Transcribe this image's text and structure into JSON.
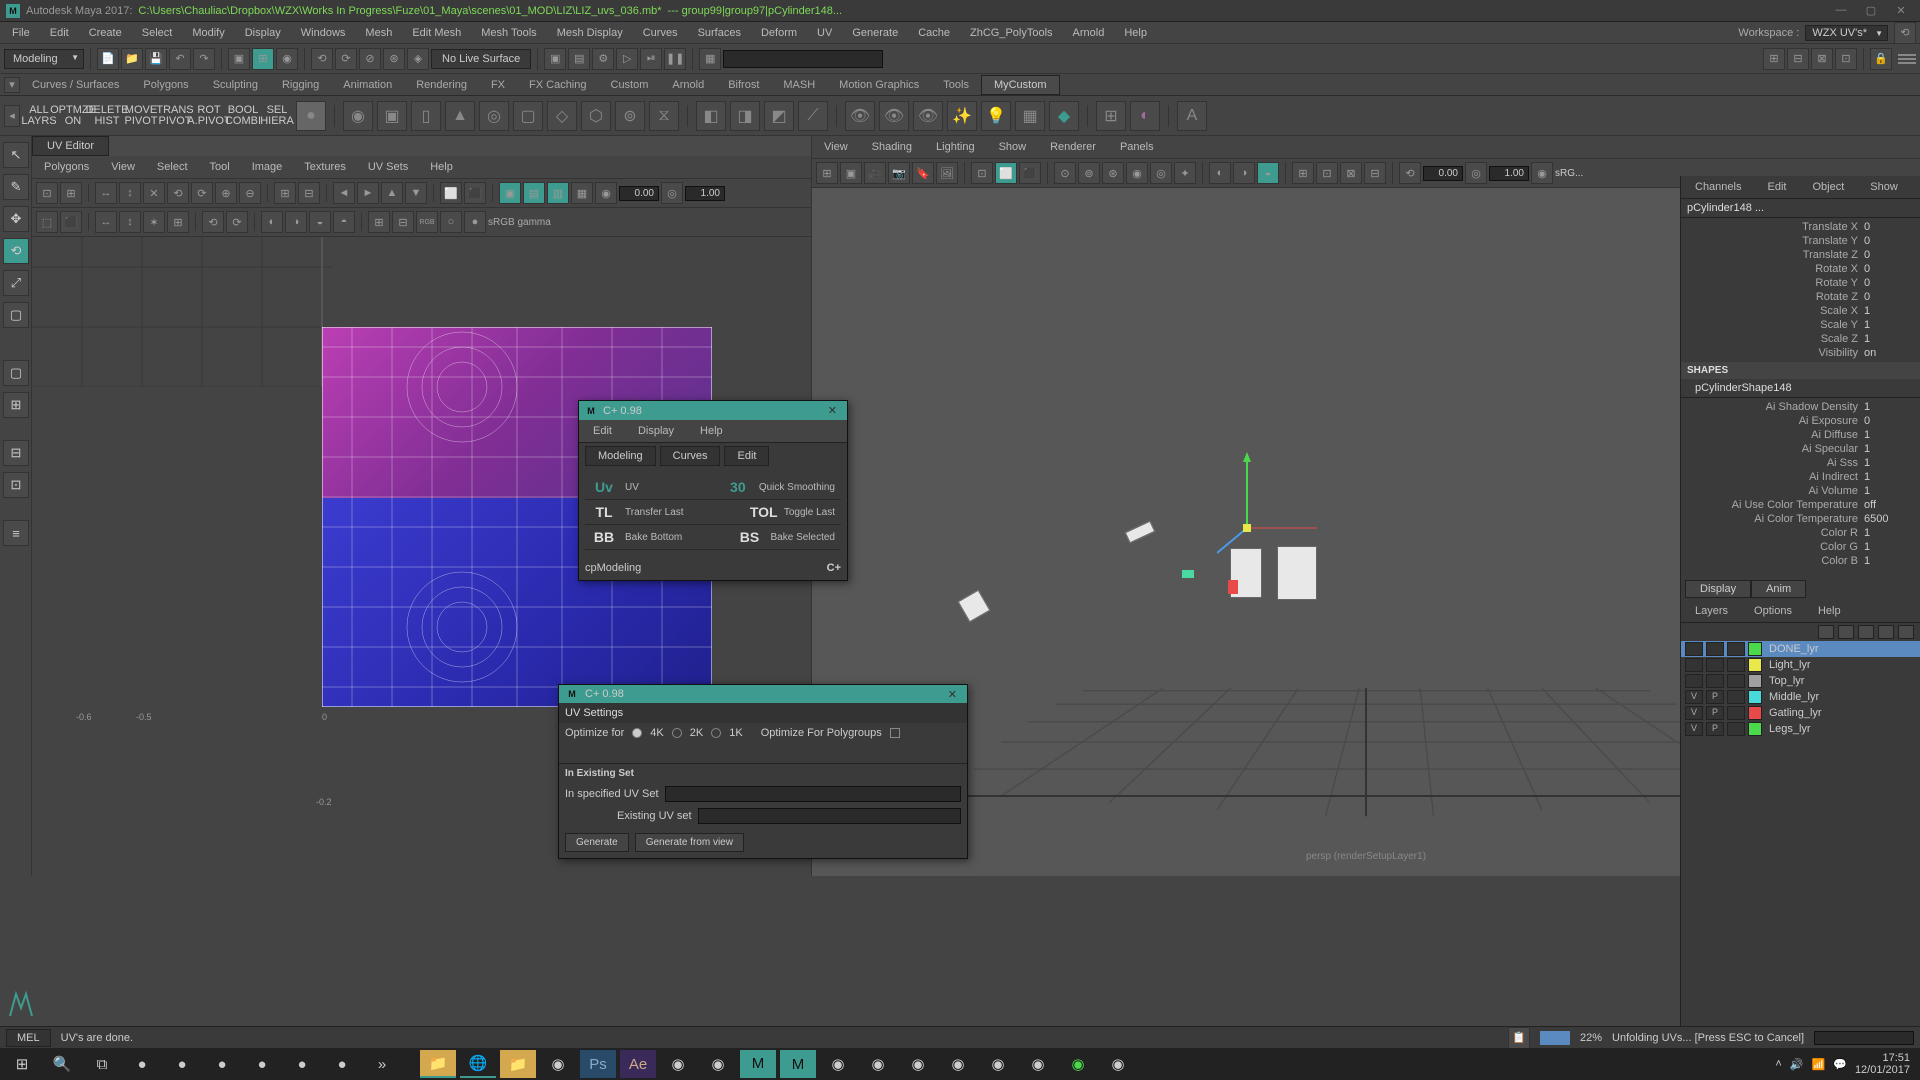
{
  "title": {
    "app": "Autodesk Maya 2017:",
    "path": "C:\\Users\\Chauliac\\Dropbox\\WZX\\Works In Progress\\Fuze\\01_Maya\\scenes\\01_MOD\\LIZ\\LIZ_uvs_036.mb*",
    "selection": "---   group99|group97|pCylinder148..."
  },
  "main_menu": [
    "File",
    "Edit",
    "Create",
    "Select",
    "Modify",
    "Display",
    "Windows",
    "Mesh",
    "Edit Mesh",
    "Mesh Tools",
    "Mesh Display",
    "Curves",
    "Surfaces",
    "Deform",
    "UV",
    "Generate",
    "Cache",
    "ZhCG_PolyTools",
    "Arnold",
    "Help"
  ],
  "workspace": {
    "label": "Workspace :",
    "value": "WZX UV's*"
  },
  "mode": "Modeling",
  "nolive": "No Live Surface",
  "shelf_tabs": [
    "Curves / Surfaces",
    "Polygons",
    "Sculpting",
    "Rigging",
    "Animation",
    "Rendering",
    "FX",
    "FX Caching",
    "Custom",
    "Arnold",
    "Bifrost",
    "MASH",
    "Motion Graphics",
    "Tools",
    "MyCustom"
  ],
  "shelf_active": 14,
  "uv_editor": {
    "title": "UV Editor",
    "menu": [
      "Polygons",
      "View",
      "Select",
      "Tool",
      "Image",
      "Textures",
      "UV Sets",
      "Help"
    ],
    "field_u": "0.00",
    "field_v": "1.00",
    "gamma": "sRGB gamma"
  },
  "vp_menu": [
    "View",
    "Shading",
    "Lighting",
    "Show",
    "Renderer",
    "Panels"
  ],
  "vp_field1": "0.00",
  "vp_field2": "1.00",
  "vp_srgb": "sRG...",
  "vp_label": "persp (renderSetupLayer1)",
  "channel_box": {
    "menu": [
      "Channels",
      "Edit",
      "Object",
      "Show"
    ],
    "node": "pCylinder148 ...",
    "transforms": [
      {
        "label": "Translate X",
        "val": "0"
      },
      {
        "label": "Translate Y",
        "val": "0"
      },
      {
        "label": "Translate Z",
        "val": "0"
      },
      {
        "label": "Rotate X",
        "val": "0"
      },
      {
        "label": "Rotate Y",
        "val": "0"
      },
      {
        "label": "Rotate Z",
        "val": "0"
      },
      {
        "label": "Scale X",
        "val": "1"
      },
      {
        "label": "Scale Y",
        "val": "1"
      },
      {
        "label": "Scale Z",
        "val": "1"
      },
      {
        "label": "Visibility",
        "val": "on"
      }
    ],
    "shapes_label": "SHAPES",
    "shape_node": "pCylinderShape148",
    "shape_attrs": [
      {
        "label": "Ai Shadow Density",
        "val": "1"
      },
      {
        "label": "Ai Exposure",
        "val": "0"
      },
      {
        "label": "Ai Diffuse",
        "val": "1"
      },
      {
        "label": "Ai Specular",
        "val": "1"
      },
      {
        "label": "Ai Sss",
        "val": "1"
      },
      {
        "label": "Ai Indirect",
        "val": "1"
      },
      {
        "label": "Ai Volume",
        "val": "1"
      },
      {
        "label": "Ai Use Color Temperature",
        "val": "off"
      },
      {
        "label": "Ai Color Temperature",
        "val": "6500"
      },
      {
        "label": "Color R",
        "val": "1"
      },
      {
        "label": "Color G",
        "val": "1"
      },
      {
        "label": "Color B",
        "val": "1"
      }
    ]
  },
  "layer_panel": {
    "tabs": [
      "Display",
      "Anim"
    ],
    "menu": [
      "Layers",
      "Options",
      "Help"
    ],
    "layers": [
      {
        "v": "",
        "p": "",
        "color": "#4ad94a",
        "name": "DONE_lyr",
        "sel": true
      },
      {
        "v": "",
        "p": "",
        "color": "#e8e84a",
        "name": "Light_lyr"
      },
      {
        "v": "",
        "p": "",
        "color": "#a0a0a0",
        "name": "Top_lyr"
      },
      {
        "v": "V",
        "p": "P",
        "color": "#4ad9d9",
        "name": "Middle_lyr"
      },
      {
        "v": "V",
        "p": "P",
        "color": "#e84a4a",
        "name": "Gatling_lyr"
      },
      {
        "v": "V",
        "p": "P",
        "color": "#4ad94a",
        "name": "Legs_lyr"
      }
    ]
  },
  "dialog1": {
    "title": "C+ 0.98",
    "menu": [
      "Edit",
      "Display",
      "Help"
    ],
    "tabs": [
      "Modeling",
      "Curves",
      "Edit"
    ],
    "rows": [
      {
        "ic": "Uv",
        "icc": "teal",
        "lab": "UV",
        "ic2": "30",
        "ic2c": "teal",
        "lab2": "Quick Smoothing"
      },
      {
        "ic": "TL",
        "icc": "",
        "lab": "Transfer Last",
        "ic2": "TOL",
        "ic2c": "",
        "lab2": "Toggle Last"
      },
      {
        "ic": "BB",
        "icc": "",
        "lab": "Bake Bottom",
        "ic2": "BS",
        "ic2c": "",
        "lab2": "Bake Selected"
      }
    ],
    "footer_label": "cpModeling",
    "footer_icon": "C+"
  },
  "dialog2": {
    "title": "C+ 0.98",
    "header": "UV Settings",
    "optimize_label": "Optimize for",
    "res": [
      "4K",
      "2K",
      "1K"
    ],
    "res_active": 0,
    "polygroups": "Optimize For Polygroups",
    "existing_hdr": "In Existing Set",
    "specified": "In specified UV Set",
    "existing": "Existing UV set",
    "generate": "Generate",
    "generate_view": "Generate from view"
  },
  "status": {
    "mel": "MEL",
    "msg": "UV's are done.",
    "percent": "22%",
    "progress": "Unfolding UVs... [Press ESC to Cancel]"
  },
  "taskbar": {
    "time": "17:51",
    "date": "12/01/2017"
  },
  "colors": {
    "teal": "#3e9b8f",
    "green": "#7ed957"
  }
}
